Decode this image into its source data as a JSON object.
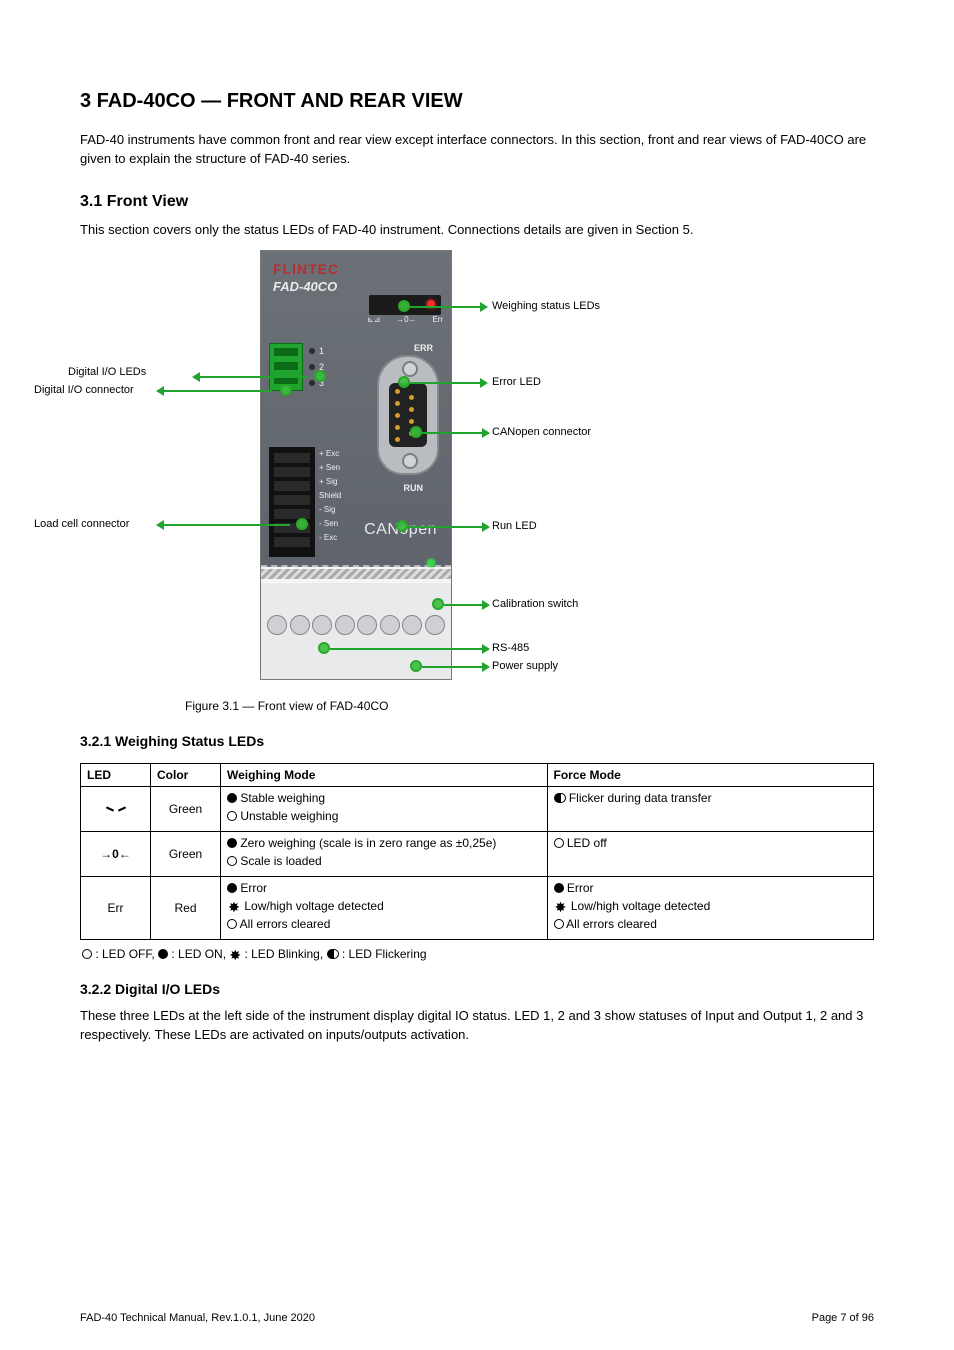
{
  "headings": {
    "h1": "3 FAD-40CO — FRONT AND REAR VIEW",
    "h2": "3.1 Front View",
    "h221": "3.2.1 Weighing Status LEDs",
    "h222": "3.2.2 Digital I/O LEDs"
  },
  "intro": {
    "p1": "FAD-40 instruments have common front and rear view except interface connectors. In this section, front and rear views of FAD-40CO are given to explain the structure of FAD-40 series.",
    "p2": "This section covers only the status LEDs of FAD-40 instrument. Connections details are given in Section 5."
  },
  "figure": {
    "caption": "Figure 3.1 — Front view of FAD-40CO",
    "callouts": {
      "status_leds": "Weighing status LEDs",
      "error_led": "Error LED",
      "canopen_conn": "CANopen connector",
      "run_led": "Run LED",
      "io_conn": "Digital I/O connector",
      "io_leds": "Digital I/O LEDs",
      "lc_conn": "Load cell connector",
      "cal_switch": "Calibration switch",
      "rs485": "RS-485",
      "power": "Power supply"
    },
    "device": {
      "brand": "FLINTEC",
      "model": "FAD-40CO",
      "led_labels": {
        "stab": "⊾⊿",
        "zero": "→0←",
        "err": "Err"
      },
      "io_led_labels": [
        "1",
        "2",
        "3"
      ],
      "err_txt": "ERR",
      "run_txt": "RUN",
      "can_txt": "CANopen",
      "sig_labels": "+ Exc\n+ Sen\n+ Sig\nShield\n- Sig\n- Sen\n- Exc"
    }
  },
  "table": {
    "headers": {
      "led": "LED",
      "color": "Color",
      "weigh": "Weighing Mode",
      "force": "Force Mode"
    },
    "legend": ": LED OFF,    : LED ON,    : LED Blinking,    : LED Flickering",
    "rows": [
      {
        "led_key": "stable",
        "color": "Green",
        "weigh": [
          {
            "sym": "on",
            "txt": "Stable weighing"
          },
          {
            "sym": "off",
            "txt": "Unstable weighing"
          }
        ],
        "force": [
          {
            "sym": "flk",
            "txt": "Flicker during data transfer"
          }
        ]
      },
      {
        "led_key": "zero",
        "color": "Green",
        "weigh": [
          {
            "sym": "on",
            "txt": "Zero weighing (scale is in zero range as ±0,25e)"
          },
          {
            "sym": "off",
            "txt": "Scale is loaded"
          }
        ],
        "force": [
          {
            "sym": "off",
            "txt": "LED off"
          }
        ]
      },
      {
        "led_key": "err_text",
        "led_txt": "Err",
        "color": "Red",
        "weigh": [
          {
            "sym": "on",
            "txt": "Error"
          },
          {
            "sym": "blk",
            "txt": "Low/high voltage detected"
          },
          {
            "sym": "off",
            "txt": "All errors cleared"
          }
        ],
        "force": [
          {
            "sym": "on",
            "txt": "Error"
          },
          {
            "sym": "blk",
            "txt": "Low/high voltage detected"
          },
          {
            "sym": "off",
            "txt": "All errors cleared"
          }
        ]
      }
    ]
  },
  "io_text": "These three LEDs at the left side of the instrument display digital IO status. LED 1, 2 and 3 show statuses of Input and Output 1, 2 and 3 respectively. These LEDs are activated on inputs/outputs activation.",
  "footer": {
    "left": "FAD-40 Technical Manual, Rev.1.0.1, June 2020",
    "right": "Page 7 of 96"
  }
}
